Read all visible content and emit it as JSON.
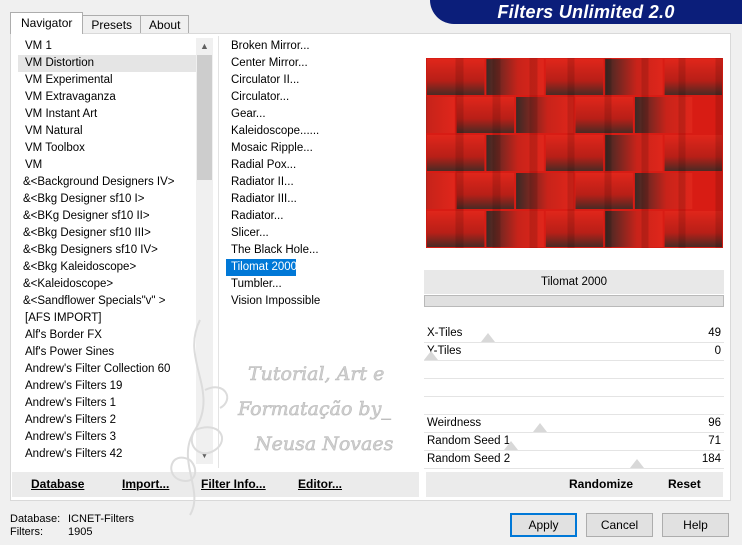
{
  "app": {
    "banner_title": "Filters Unlimited 2.0"
  },
  "tabs": [
    {
      "label": "Navigator",
      "active": true
    },
    {
      "label": "Presets",
      "active": false
    },
    {
      "label": "About",
      "active": false
    }
  ],
  "categories": {
    "items": [
      "VM 1",
      "VM Distortion",
      "VM Experimental",
      "VM Extravaganza",
      "VM Instant Art",
      "VM Natural",
      "VM Toolbox",
      "VM",
      "&<Background Designers IV>",
      "&<Bkg Designer sf10 I>",
      "&<BKg Designer sf10 II>",
      "&<Bkg Designer sf10 III>",
      "&<Bkg Designers sf10 IV>",
      "&<Bkg Kaleidoscope>",
      "&<Kaleidoscope>",
      "&<Sandflower Specials\"v\" >",
      "[AFS IMPORT]",
      "Alf's Border FX",
      "Alf's Power Sines",
      "Andrew's Filter Collection 60",
      "Andrew's Filters 19",
      "Andrew's Filters 1",
      "Andrew's Filters 2",
      "Andrew's Filters 3",
      "Andrew's Filters 42"
    ],
    "selected_index": 1
  },
  "filters": {
    "items": [
      "Broken Mirror...",
      "Center Mirror...",
      "Circulator II...",
      "Circulator...",
      "Gear...",
      "Kaleidoscope......",
      "Mosaic Ripple...",
      "Radial Pox...",
      "Radiator II...",
      "Radiator III...",
      "Radiator...",
      "Slicer...",
      "The Black Hole...",
      "Tilomat 2000",
      "Tumbler...",
      "Vision Impossible"
    ],
    "selected_index": 13
  },
  "preview": {
    "filter_name": "Tilomat 2000",
    "progress": 0
  },
  "sliders": [
    {
      "label": "X-Tiles",
      "value": "49",
      "level": 0.2
    },
    {
      "label": "Y-Tiles",
      "value": "0",
      "level": 0.0
    },
    {
      "label": "",
      "value": "",
      "level": null
    },
    {
      "label": "",
      "value": "",
      "level": null
    },
    {
      "label": "",
      "value": "",
      "level": null
    },
    {
      "label": "Weirdness",
      "value": "96",
      "level": 0.38
    },
    {
      "label": "Random Seed 1",
      "value": "71",
      "level": 0.28
    },
    {
      "label": "Random Seed 2",
      "value": "184",
      "level": 0.72
    }
  ],
  "buttons": {
    "database": "Database",
    "import": "Import...",
    "filter_info": "Filter Info...",
    "editor": "Editor...",
    "randomize": "Randomize",
    "reset": "Reset",
    "apply": "Apply",
    "cancel": "Cancel",
    "help": "Help"
  },
  "status": {
    "database_label": "Database:",
    "database_value": "ICNET-Filters",
    "filters_label": "Filters:",
    "filters_value": "1905"
  },
  "watermark": {
    "line1": "Tutorial, Art e",
    "line2": "Formatação by_",
    "line3": "Neusa Novaes"
  },
  "colors": {
    "banner": "#0b1e7a",
    "selection": "#0078d7",
    "preview_red": "#d81c14"
  }
}
